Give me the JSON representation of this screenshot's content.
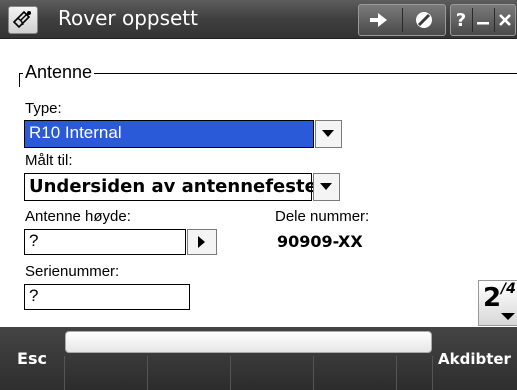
{
  "titlebar": {
    "title": "Rover oppsett",
    "app_icon": "satellite-dish-icon",
    "buttons": [
      "map-arrow-icon",
      "no-entry-icon"
    ],
    "help_label": "?",
    "minimize_label": "—",
    "close_label": "✕"
  },
  "antenna": {
    "group_label": "Antenne",
    "type_label": "Type:",
    "type_value": "R10 Internal",
    "measured_label": "Målt til:",
    "measured_value": "Undersiden av antennefestet",
    "height_label": "Antenne høyde:",
    "height_value": "?",
    "part_label": "Dele nummer:",
    "part_value": "90909-XX",
    "serial_label": "Serienummer:",
    "serial_value": "?"
  },
  "pager": {
    "current": "2",
    "total": "/4"
  },
  "softkeys": {
    "esc": "Esc",
    "accept": "Akdibter"
  },
  "colors": {
    "selection": "#2a5ad8",
    "titlebar": "#4a4a4a",
    "softbar": "#333333"
  }
}
